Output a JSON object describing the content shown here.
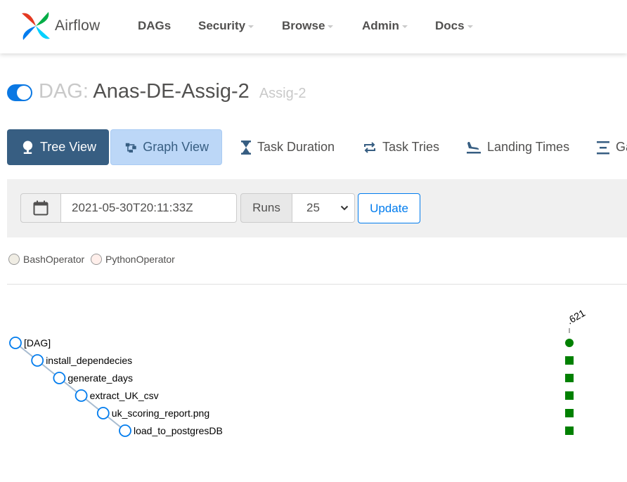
{
  "brand": {
    "name": "Airflow"
  },
  "nav": {
    "items": [
      {
        "label": "DAGs",
        "dropdown": false
      },
      {
        "label": "Security",
        "dropdown": true
      },
      {
        "label": "Browse",
        "dropdown": true
      },
      {
        "label": "Admin",
        "dropdown": true
      },
      {
        "label": "Docs",
        "dropdown": true
      }
    ]
  },
  "dag": {
    "prefix": "DAG:",
    "name": "Anas-DE-Assig-2",
    "subtitle": "Assig-2",
    "paused": false
  },
  "tabs": [
    {
      "label": "Tree View",
      "icon": "tree-icon",
      "active": true
    },
    {
      "label": "Graph View",
      "icon": "graph-icon",
      "active": false
    },
    {
      "label": "Task Duration",
      "icon": "hourglass-icon",
      "active": false
    },
    {
      "label": "Task Tries",
      "icon": "retry-icon",
      "active": false
    },
    {
      "label": "Landing Times",
      "icon": "plane-landing-icon",
      "active": false
    },
    {
      "label": "Ga",
      "icon": "gantt-icon",
      "active": false
    }
  ],
  "controls": {
    "base_date": "2021-05-30T20:11:33Z",
    "runs_label": "Runs",
    "runs_value": "25",
    "update_label": "Update"
  },
  "legend": [
    {
      "label": "BashOperator",
      "color": "#f0ede4"
    },
    {
      "label": "PythonOperator",
      "color": "#ffefeb"
    }
  ],
  "tree": {
    "run_label": ".621",
    "nodes": [
      {
        "label": "[DAG]",
        "state": "success"
      },
      {
        "label": "install_dependecies",
        "state": "success"
      },
      {
        "label": "generate_days",
        "state": "success"
      },
      {
        "label": "extract_UK_csv",
        "state": "success"
      },
      {
        "label": "uk_scoring_report.png",
        "state": "success"
      },
      {
        "label": "load_to_postgresDB",
        "state": "success"
      }
    ]
  },
  "colors": {
    "primary": "#017cee",
    "active_tab": "#375e82",
    "success": "#008000",
    "node_stroke": "#017cee"
  }
}
